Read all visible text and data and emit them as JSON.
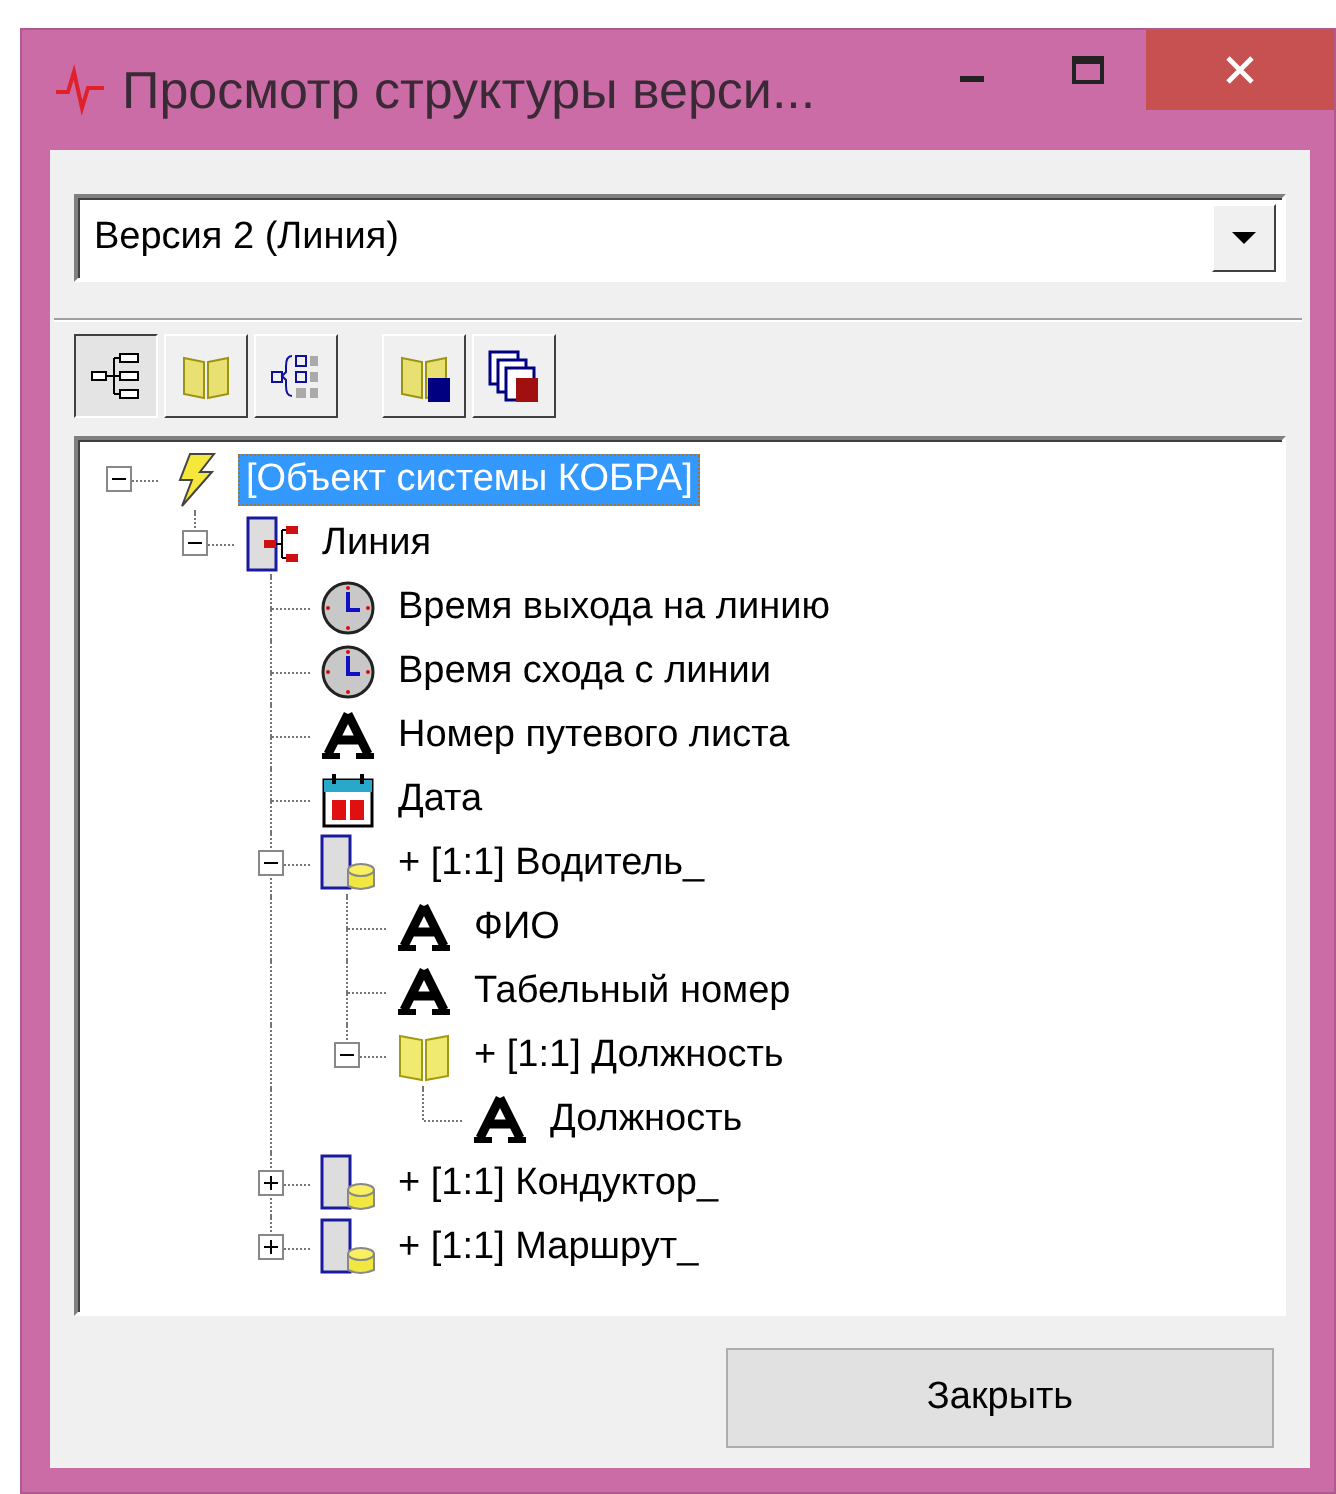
{
  "window": {
    "title": "Просмотр структуры верси..."
  },
  "version_select": {
    "value": "Версия 2 (Линия)"
  },
  "toolbar": [
    {
      "kind": "tree",
      "selected": true
    },
    {
      "kind": "book",
      "selected": false
    },
    {
      "kind": "fields",
      "selected": false
    },
    {
      "kind": "book-new",
      "selected": false
    },
    {
      "kind": "pages-new",
      "selected": false
    }
  ],
  "tree": [
    {
      "label": "[Объект системы КОБРА]",
      "kind": "bolt",
      "selected": true,
      "expanded": true,
      "children": [
        {
          "label": "Линия",
          "kind": "entity",
          "selected": false,
          "expanded": true,
          "children": [
            {
              "label": "Время выхода на линию",
              "kind": "clock",
              "selected": false
            },
            {
              "label": "Время схода с линии",
              "kind": "clock",
              "selected": false
            },
            {
              "label": "Номер путевого листа",
              "kind": "text",
              "selected": false
            },
            {
              "label": "Дата",
              "kind": "calendar",
              "selected": false
            },
            {
              "label": "+ [1:1] Водитель_",
              "kind": "table",
              "selected": false,
              "expanded": true,
              "children": [
                {
                  "label": "ФИО",
                  "kind": "text",
                  "selected": false
                },
                {
                  "label": "Табельный номер",
                  "kind": "text",
                  "selected": false
                },
                {
                  "label": "+ [1:1] Должность",
                  "kind": "book",
                  "selected": false,
                  "expanded": true,
                  "children": [
                    {
                      "label": "Должность",
                      "kind": "text",
                      "selected": false
                    }
                  ]
                }
              ]
            },
            {
              "label": "+ [1:1] Кондуктор_",
              "kind": "table",
              "selected": false,
              "expanded": false
            },
            {
              "label": "+ [1:1] Маршрут_",
              "kind": "table",
              "selected": false,
              "expanded": false
            }
          ]
        }
      ]
    }
  ],
  "buttons": [
    {
      "label": "Закрыть"
    }
  ]
}
